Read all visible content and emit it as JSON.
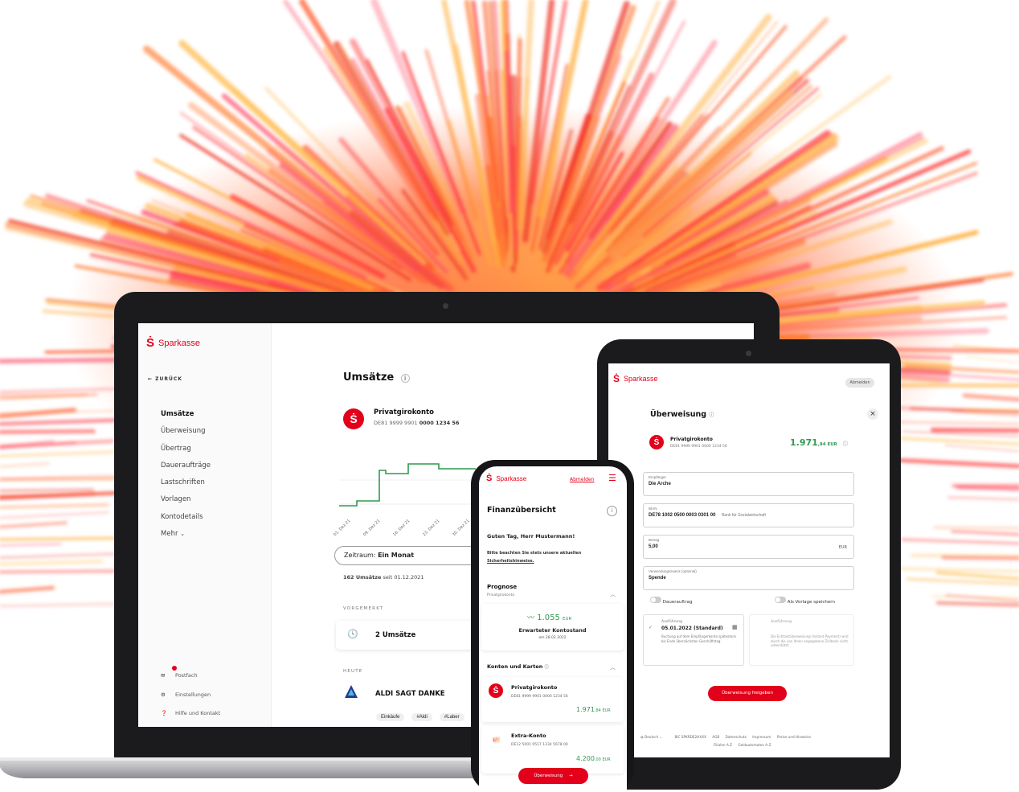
{
  "brand": {
    "name": "Sparkasse",
    "color": "#e2001a"
  },
  "laptop": {
    "back_label": "ZURÜCK",
    "nav": [
      "Umsätze",
      "Überweisung",
      "Übertrag",
      "Daueraufträge",
      "Lastschriften",
      "Vorlagen",
      "Kontodetails",
      "Mehr"
    ],
    "bottom_nav": [
      "Postfach",
      "Einstellungen",
      "Hilfe und Kontakt"
    ],
    "page_title": "Umsätze",
    "account": {
      "name": "Privatgirokonto",
      "iban_prefix": "DE81 9999 9901",
      "iban_suffix": "0000 1234 56"
    },
    "chart_dates": [
      "01. Dez 21",
      "09. Dez 21",
      "16. Dez 21",
      "23. Dez 21",
      "30. Dez 21"
    ],
    "period_label": "Zeitraum:",
    "period_value": "Ein Monat",
    "count_bold": "162 Umsätze",
    "count_rest": "seit 01.12.2021",
    "section_pending": "VORGEMERKT",
    "pending_text": "2 Umsätze",
    "section_today": "HEUTE",
    "transaction": {
      "name": "ALDI SAGT DANKE",
      "tags": [
        "Einkäufe",
        "#Aldi",
        "#Laber"
      ]
    }
  },
  "tablet": {
    "logout_label": "Abmelden",
    "title": "Überweisung",
    "account": {
      "name": "Privatgirokonto",
      "iban": "DE81 9999 9901 0000 1234 56",
      "balance": "1.971",
      "balance_cents": ",84 EUR"
    },
    "fields": [
      {
        "label": "Empfänger",
        "value": "Die Arche"
      },
      {
        "label": "IBAN",
        "value": "DE78 1002 0500 0003 0301 00",
        "extra": "Bank für Sozialwirtschaft"
      },
      {
        "label": "Betrag",
        "value": "5,00",
        "extra": "EUR"
      },
      {
        "label": "Verwendungszweck (optional)",
        "value": "Spende"
      }
    ],
    "toggle1": "Dauerauftrag",
    "toggle2": "Als Vorlage speichern",
    "exec_label": "Ausführung",
    "exec_value": "05.01.2022 (Standard)",
    "exec_note": "Buchung auf dem Empfängerkonto spätestens bis Ende übernächsten Geschäftstag.",
    "exec2_label": "Ausführung",
    "exec2_note": "Die Echtzeitüberweisung (Instant Payment) wird durch die von Ihnen angegebene Zielbank nicht unterstützt.",
    "submit": "Überweisung freigeben",
    "footer_lang": "Deutsch",
    "footer_links": [
      "BIC SPKRDE2HXXX",
      "AGB",
      "Datenschutz",
      "Impressum",
      "Preise und Hinweise"
    ],
    "footer_links2": [
      "Filialen A-Z",
      "Geldautomaten A-Z"
    ]
  },
  "phone": {
    "logout_label": "Abmelden",
    "title": "Finanzübersicht",
    "greeting": "Guten Tag, Herr Mustermann!",
    "notice": "Bitte beachten Sie stets unsere aktuellen",
    "notice_link": "Sicherheitshinweise.",
    "forecast_title": "Prognose",
    "forecast_sub": "Privatgirokonto",
    "forecast_value": "1.055",
    "forecast_unit": "EUR",
    "forecast_label": "Erwarteter Kontostand",
    "forecast_date": "am 28.02.2022",
    "accounts_title": "Konten und Karten",
    "accounts": [
      {
        "name": "Privatgirokonto",
        "iban": "DE81 9999 9901 0000 1234 56",
        "balance": "1.971",
        "cents": ",84 EUR"
      },
      {
        "name": "Extra-Konto",
        "iban": "DE12 5001 0517 1234 5678 00",
        "balance": "4.200",
        "cents": ",00 EUR"
      }
    ],
    "button": "Überweisung"
  }
}
